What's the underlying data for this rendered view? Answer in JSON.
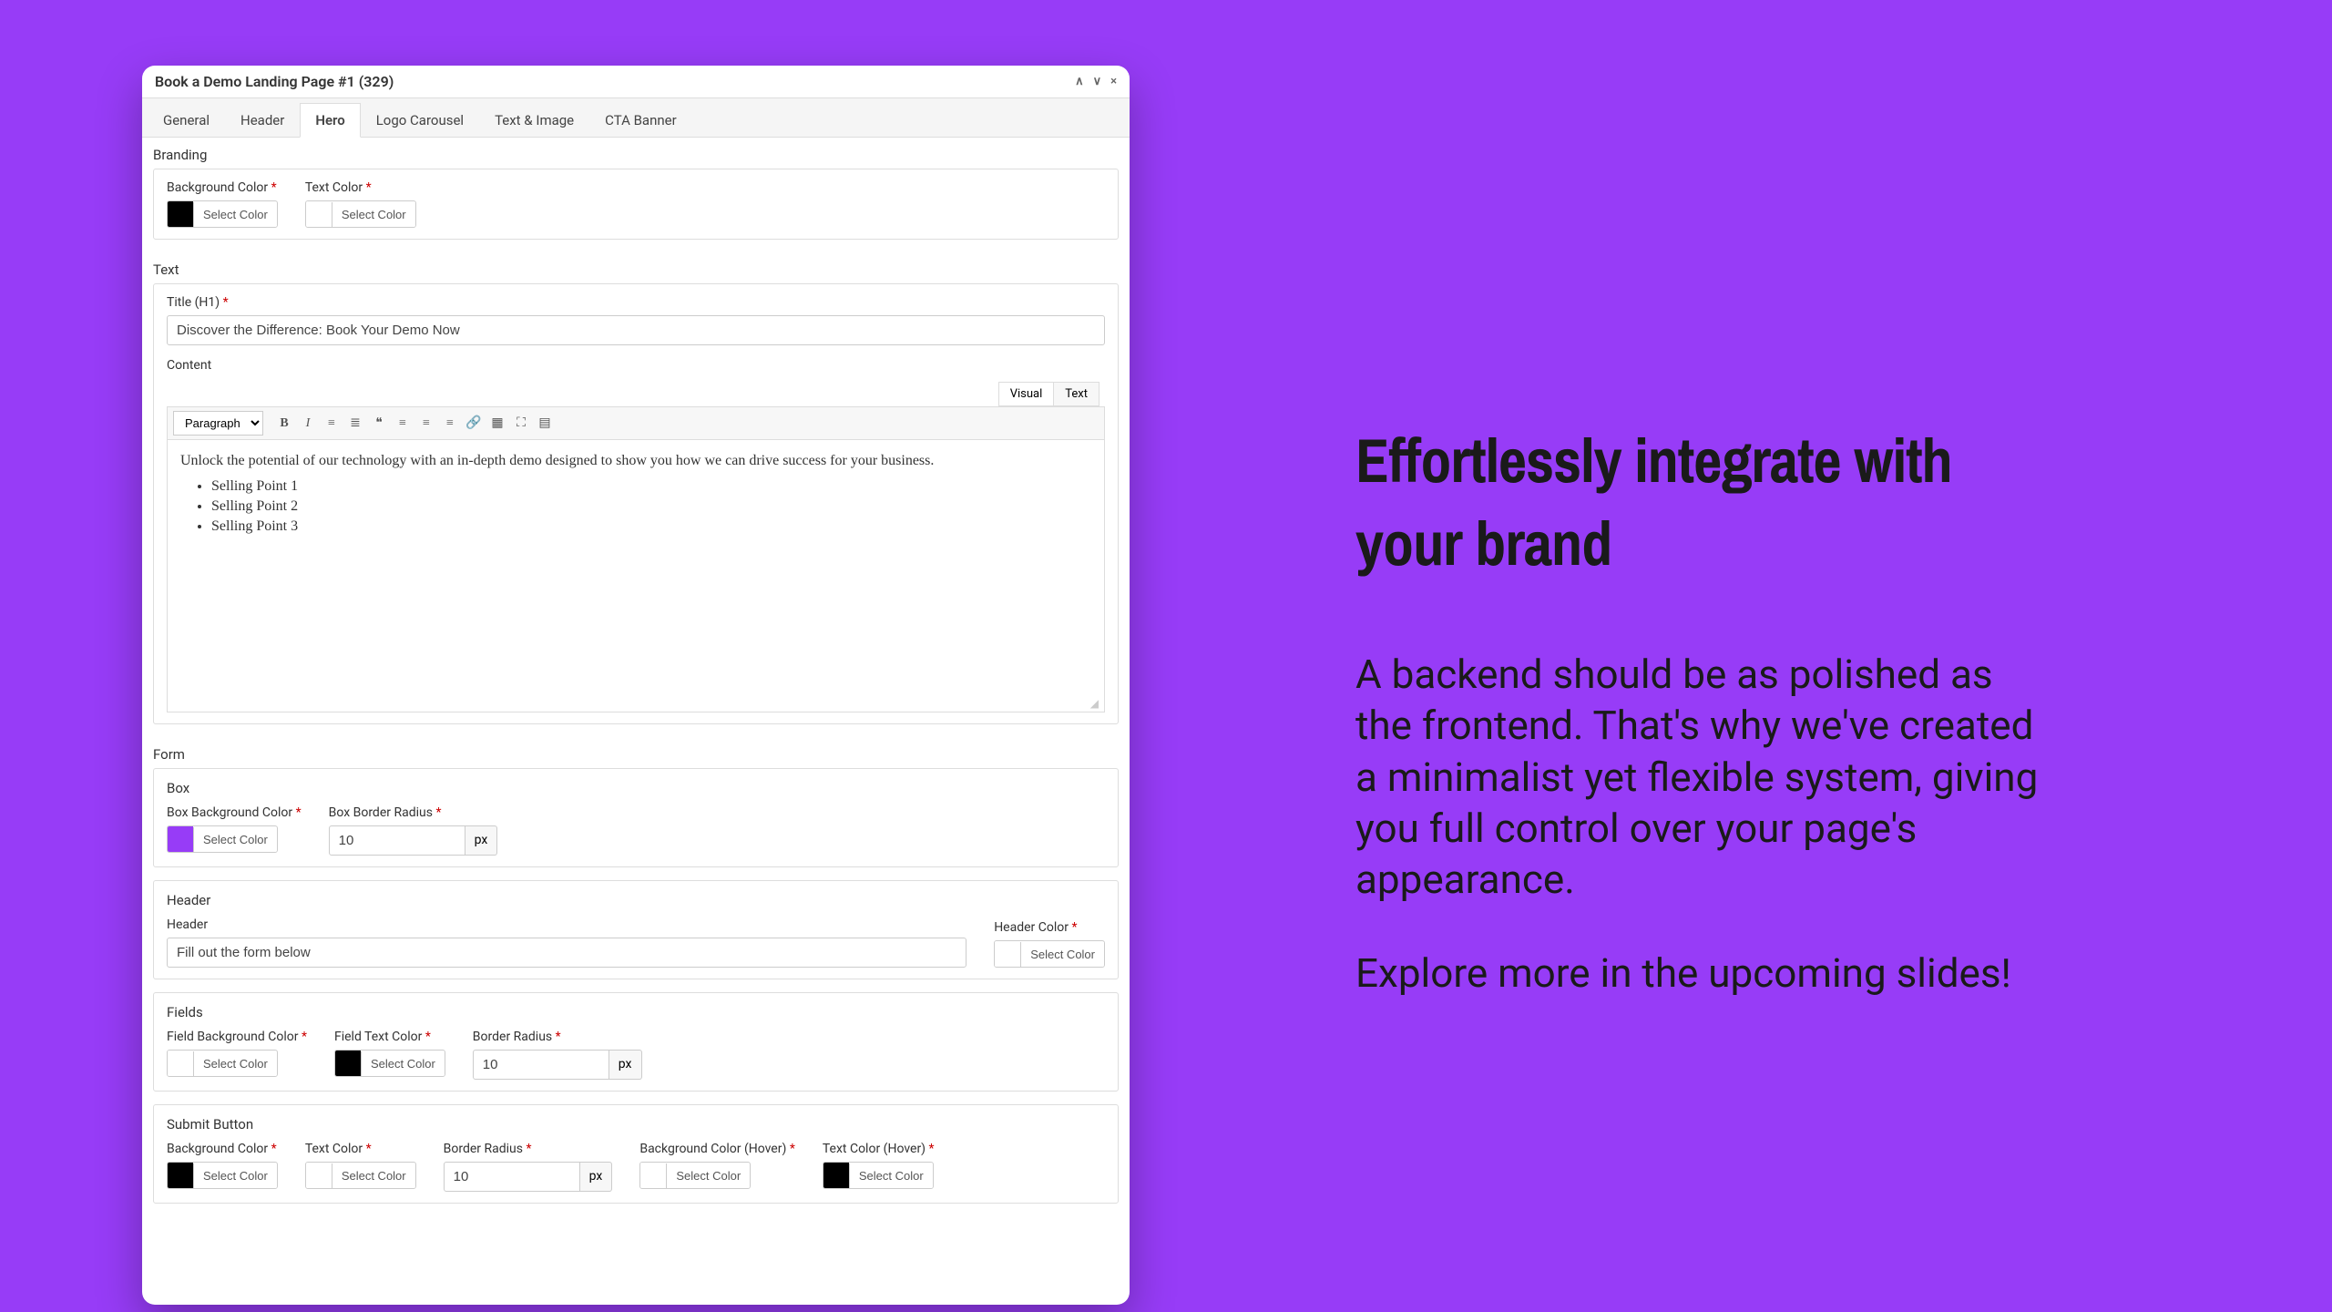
{
  "window": {
    "title": "Book a Demo Landing Page #1 (329)"
  },
  "tabs": [
    "General",
    "Header",
    "Hero",
    "Logo Carousel",
    "Text & Image",
    "CTA Banner"
  ],
  "active_tab": 2,
  "branding": {
    "section_label": "Branding",
    "bg_color_label": "Background Color",
    "text_color_label": "Text Color",
    "select_color": "Select Color"
  },
  "text_section": {
    "section_label": "Text",
    "title_label": "Title (H1)",
    "title_value": "Discover the Difference: Book Your Demo Now",
    "content_label": "Content",
    "visual": "Visual",
    "text_tab": "Text",
    "format_select": "Paragraph",
    "content_paragraph": "Unlock the potential of our technology with an in-depth demo designed to show you how we can drive success for your business.",
    "points": [
      "Selling Point 1",
      "Selling Point 2",
      "Selling Point 3"
    ]
  },
  "form_section": {
    "section_label": "Form",
    "box": {
      "label": "Box",
      "bg_label": "Box Background Color",
      "radius_label": "Box Border Radius",
      "radius_value": "10",
      "unit": "px"
    },
    "header": {
      "label": "Header",
      "field_label": "Header",
      "field_value": "Fill out the form below",
      "color_label": "Header Color"
    },
    "fields": {
      "label": "Fields",
      "bg_label": "Field Background Color",
      "text_label": "Field Text Color",
      "radius_label": "Border Radius",
      "radius_value": "10",
      "unit": "px"
    },
    "submit": {
      "label": "Submit Button",
      "bg_label": "Background Color",
      "text_label": "Text Color",
      "radius_label": "Border Radius",
      "radius_value": "10",
      "unit": "px",
      "bg_hover_label": "Background Color (Hover)",
      "text_hover_label": "Text Color (Hover)"
    }
  },
  "select_color": "Select Color",
  "marketing": {
    "heading": "Effortlessly integrate with your brand",
    "body1": "A backend should be as polished as the frontend. That's why we've created a minimalist yet flexible system, giving you full control over your page's appearance.",
    "body2": "Explore more in the upcoming slides!"
  }
}
